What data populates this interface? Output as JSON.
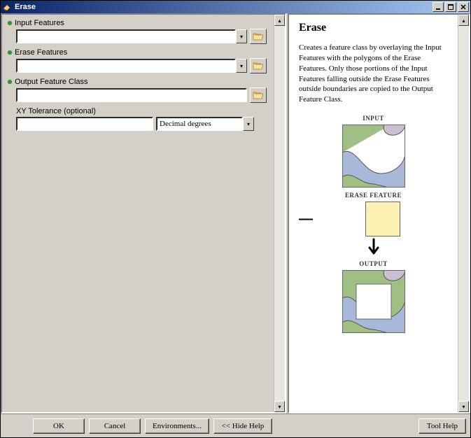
{
  "window": {
    "title": "Erase"
  },
  "form": {
    "input_features": {
      "label": "Input Features",
      "value": ""
    },
    "erase_features": {
      "label": "Erase Features",
      "value": ""
    },
    "output_feature_class": {
      "label": "Output Feature Class",
      "value": ""
    },
    "xy_tolerance": {
      "label": "XY Tolerance (optional)",
      "value": "",
      "unit_selected": "Decimal degrees"
    }
  },
  "help": {
    "title": "Erase",
    "description": "Creates a feature class by overlaying the Input Features with the polygons of the Erase Features. Only those portions of the Input Features falling outside the Erase Features outside boundaries are copied to the Output Feature Class.",
    "diagram_labels": {
      "input": "INPUT",
      "erase": "ERASE FEATURE",
      "output": "OUTPUT"
    }
  },
  "buttons": {
    "ok": "OK",
    "cancel": "Cancel",
    "environments": "Environments...",
    "hide_help": "<< Hide Help",
    "tool_help": "Tool Help"
  },
  "icons": {
    "app": "erase-tool-icon",
    "minimize": "minimize-icon",
    "maximize": "maximize-icon",
    "close": "close-icon",
    "browse": "folder-open-icon",
    "dropdown": "chevron-down-icon",
    "scroll_up": "chevron-up-icon",
    "scroll_down": "chevron-down-icon"
  }
}
